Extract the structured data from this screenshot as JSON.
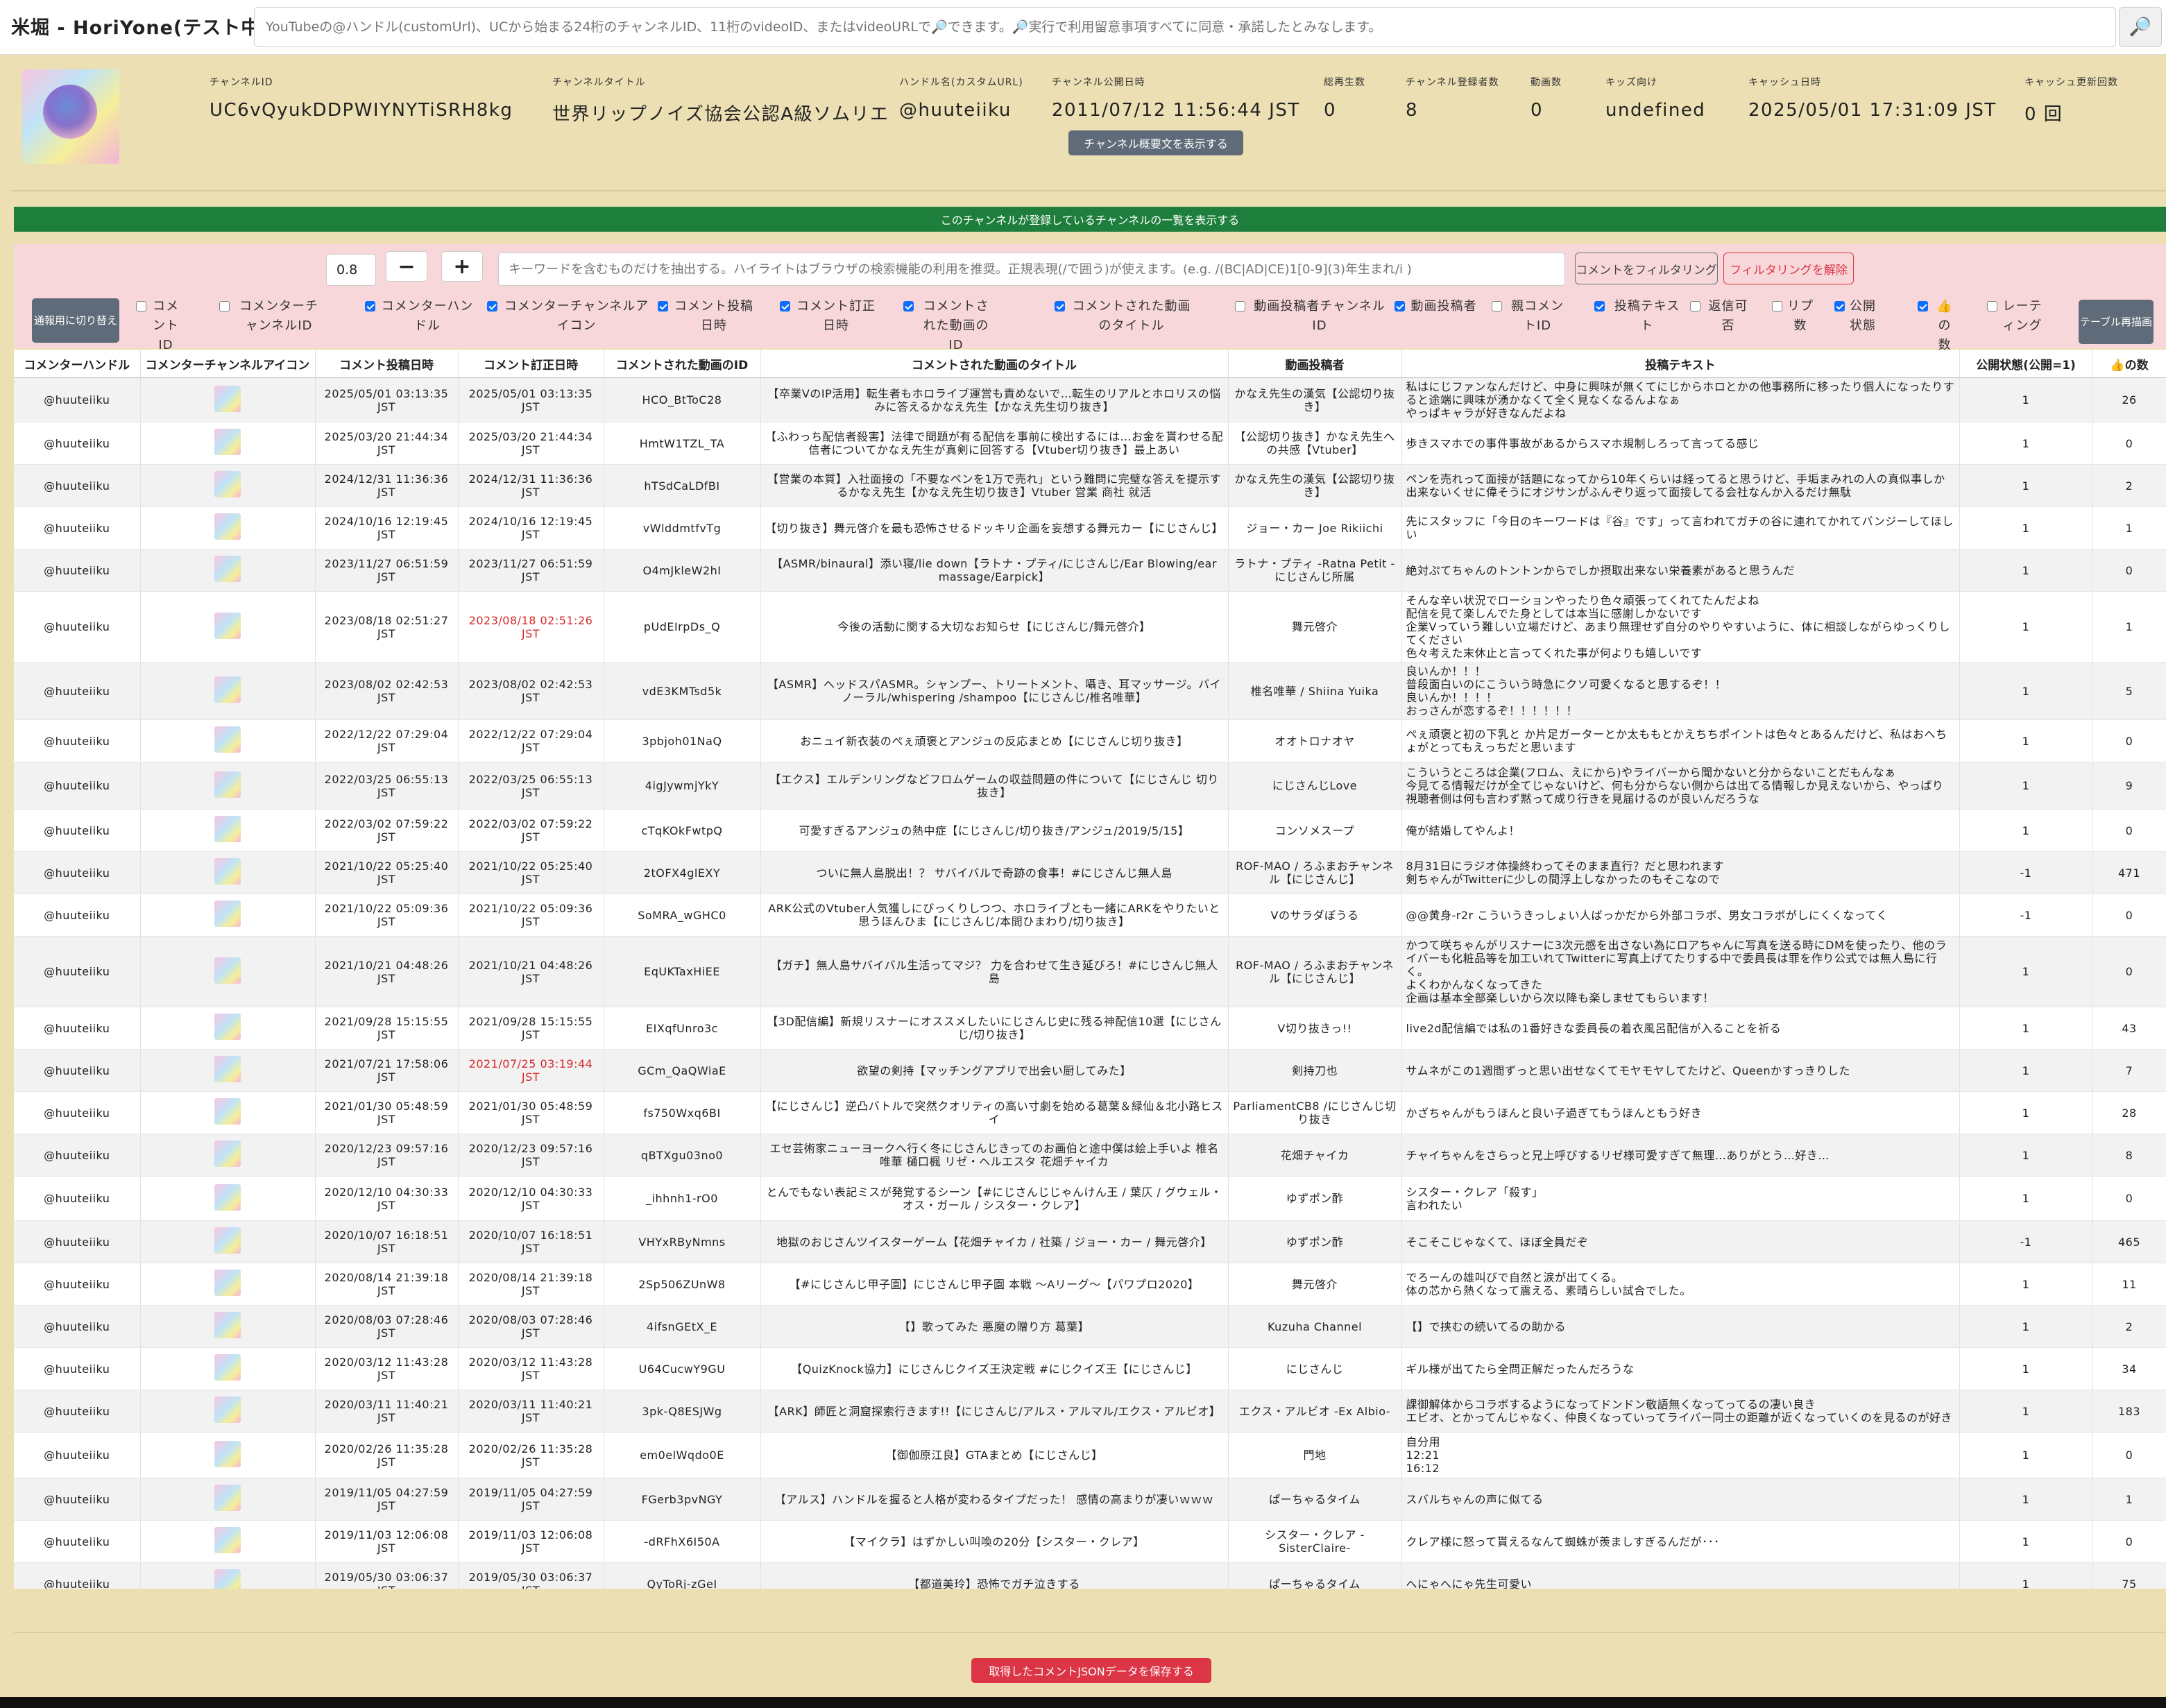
{
  "app": {
    "title": "米堀 - HoriYone(テスト中)"
  },
  "search": {
    "placeholder": "YouTubeの@ハンドル(customUrl)、UCから始まる24桁のチャンネルID、11桁のvideoID、またはvideoURLで🔎できます。🔎実行で利用留意事項すべてに同意・承諾したとみなします。",
    "icon": "search-icon"
  },
  "channel": {
    "fields": [
      {
        "label": "チャンネルID",
        "value": "UC6vQyukDDPWIYNYTiSRH8kg"
      },
      {
        "label": "チャンネルタイトル",
        "value": "世界リップノイズ協会公認A級ソムリエ"
      },
      {
        "label": "ハンドル名(カスタムURL)",
        "value": "@huuteiiku"
      },
      {
        "label": "チャンネル公開日時",
        "value": "2011/07/12 11:56:44 JST"
      },
      {
        "label": "総再生数",
        "value": "0"
      },
      {
        "label": "チャンネル登録者数",
        "value": "8"
      },
      {
        "label": "動画数",
        "value": "0"
      },
      {
        "label": "キッズ向け",
        "value": "undefined"
      },
      {
        "label": "キャッシュ日時",
        "value": "2025/05/01 17:31:09 JST"
      },
      {
        "label": "キャッシュ更新回数",
        "value": "0 回"
      }
    ],
    "desc_button": "チャンネル概要文を表示する"
  },
  "subscriptions_button": "このチャンネルが登録しているチャンネルの一覧を表示する",
  "filter": {
    "threshold": "0.8",
    "minus": "−",
    "plus": "+",
    "keyword_placeholder": "キーワードを含むものだけを抽出する。ハイライトはブラウザの検索機能の利用を推奨。正規表現(/で囲う)が使えます。(e.g. /(BC|AD|CE)1[0-9](3)年生まれ/i )",
    "filter_button": "コメントをフィルタリング",
    "clear_button": "フィルタリングを解除",
    "print_toggle": "通報用に切り替え",
    "redraw": "テーブル再描画"
  },
  "columns_toggle": [
    {
      "label": "コメントID",
      "checked": false
    },
    {
      "label": "コメンターチャンネルID",
      "checked": false
    },
    {
      "label": "コメンターハンドル",
      "checked": true
    },
    {
      "label": "コメンターチャンネルアイコン",
      "checked": true
    },
    {
      "label": "コメント投稿日時",
      "checked": true
    },
    {
      "label": "コメント訂正日時",
      "checked": true
    },
    {
      "label": "コメントされた動画のID",
      "checked": true
    },
    {
      "label": "コメントされた動画のタイトル",
      "checked": true
    },
    {
      "label": "動画投稿者チャンネルID",
      "checked": false
    },
    {
      "label": "動画投稿者",
      "checked": true
    },
    {
      "label": "親コメントID",
      "checked": false
    },
    {
      "label": "投稿テキスト",
      "checked": true
    },
    {
      "label": "返信可否",
      "checked": false
    },
    {
      "label": "リプ数",
      "checked": false
    },
    {
      "label": "公開状態",
      "checked": true
    },
    {
      "label": "👍の数",
      "checked": true
    },
    {
      "label": "レーティング",
      "checked": false
    }
  ],
  "table": {
    "headers": [
      "コメンターハンドル",
      "コメンターチャンネルアイコン",
      "コメント投稿日時",
      "コメント訂正日時",
      "コメントされた動画のID",
      "コメントされた動画のタイトル",
      "動画投稿者",
      "投稿テキスト",
      "公開状態(公開=1)",
      "👍の数"
    ],
    "rows": [
      {
        "handle": "@huuteiiku",
        "posted": "2025/05/01 03:13:35\nJST",
        "edited": "2025/05/01 03:13:35\nJST",
        "edited_red": false,
        "vid": "HCO_BtToC28",
        "title": "【卒業VのIP活用】転生者もホロライブ運営も責めないで…転生のリアルとホロリスの悩みに答えるかなえ先生【かなえ先生切り抜き】",
        "author": "かなえ先生の漢気【公認切り抜き】",
        "text": "私はにじファンなんだけど、中身に興味が無くてにじからホロとかの他事務所に移ったり個人になったりすると途端に興味が湧かなくて全く見なくなるんよなぁ\nやっぱキャラが好きなんだよね",
        "status": "1",
        "likes": "26"
      },
      {
        "handle": "@huuteiiku",
        "posted": "2025/03/20 21:44:34\nJST",
        "edited": "2025/03/20 21:44:34\nJST",
        "edited_red": false,
        "vid": "HmtW1TZL_TA",
        "title": "【ふわっち配信者殺害】法律で問題が有る配信を事前に検出するには…お金を貰わせる配信者についてかなえ先生が真剣に回答する【Vtuber切り抜き】最上あい",
        "author": "【公認切り抜き】かなえ先生への共感【Vtuber】",
        "text": "歩きスマホでの事件事故があるからスマホ規制しろって言ってる感じ",
        "status": "1",
        "likes": "0"
      },
      {
        "handle": "@huuteiiku",
        "posted": "2024/12/31 11:36:36\nJST",
        "edited": "2024/12/31 11:36:36\nJST",
        "edited_red": false,
        "vid": "hTSdCaLDfBI",
        "title": "【営業の本質】入社面接の「不要なペンを1万で売れ」という難問に完璧な答えを提示するかなえ先生【かなえ先生切り抜き】Vtuber 営業 商社 就活",
        "author": "かなえ先生の漢気【公認切り抜き】",
        "text": "ペンを売れって面接が話題になってから10年くらいは経ってると思うけど、手垢まみれの人の真似事しか出来ないくせに偉そうにオジサンがふんぞり返って面接してる会社なんか入るだけ無駄",
        "status": "1",
        "likes": "2"
      },
      {
        "handle": "@huuteiiku",
        "posted": "2024/10/16 12:19:45\nJST",
        "edited": "2024/10/16 12:19:45\nJST",
        "edited_red": false,
        "vid": "vWlddmtfvTg",
        "title": "【切り抜き】舞元啓介を最も恐怖させるドッキリ企画を妄想する舞元カー【にじさんじ】",
        "author": "ジョー・カー Joe Rikiichi",
        "text": "先にスタッフに「今日のキーワードは『谷』です」って言われてガチの谷に連れてかれてバンジーしてほしい",
        "status": "1",
        "likes": "1"
      },
      {
        "handle": "@huuteiiku",
        "posted": "2023/11/27 06:51:59\nJST",
        "edited": "2023/11/27 06:51:59\nJST",
        "edited_red": false,
        "vid": "O4mJkleW2hI",
        "title": "【ASMR/binaural】添い寝/lie down【ラトナ・プティ/にじさんじ/Ear Blowing/ear massage/Earpick】",
        "author": "ラトナ・プティ -Ratna Petit -にじさんじ所属",
        "text": "絶対ぷてちゃんのトントンからでしか摂取出来ない栄養素があると思うんだ",
        "status": "1",
        "likes": "0"
      },
      {
        "handle": "@huuteiiku",
        "posted": "2023/08/18 02:51:27\nJST",
        "edited": "2023/08/18 02:51:26\nJST",
        "edited_red": true,
        "vid": "pUdEIrpDs_Q",
        "title": "今後の活動に関する大切なお知らせ【にじさんじ/舞元啓介】",
        "author": "舞元啓介",
        "text": "そんな辛い状況でローションやったり色々頑張ってくれてたんだよね\n配信を見て楽しんでた身としては本当に感謝しかないです\n企業Vっていう難しい立場だけど、あまり無理せず自分のやりやすいように、体に相談しながらゆっくりしてください\n色々考えた末休止と言ってくれた事が何よりも嬉しいです",
        "status": "1",
        "likes": "1"
      },
      {
        "handle": "@huuteiiku",
        "posted": "2023/08/02 02:42:53\nJST",
        "edited": "2023/08/02 02:42:53\nJST",
        "edited_red": false,
        "vid": "vdE3KMTsd5k",
        "title": "【ASMR】ヘッドスパASMR。シャンプー、トリートメント、囁き、耳マッサージ。バイノーラル/whispering /shampoo【にじさんじ/椎名唯華】",
        "author": "椎名唯華 / Shiina Yuika",
        "text": "良いんか！！！\n普段面白いのにこういう時急にクソ可愛くなると思するぞ！！\n良いんか！！！！\nおっさんが恋するぞ！！！！！！",
        "status": "1",
        "likes": "5"
      },
      {
        "handle": "@huuteiiku",
        "posted": "2022/12/22 07:29:04\nJST",
        "edited": "2022/12/22 07:29:04\nJST",
        "edited_red": false,
        "vid": "3pbjoh01NaQ",
        "title": "おニュイ新衣装のぺぇ頑褒とアンジュの反応まとめ【にじさんじ切り抜き】",
        "author": "オオトロナオヤ",
        "text": "ぺぇ頑褒と初の下乳と か片足ガーターとか太ももとかえちちポイントは色々とあるんだけど、私はおへちょがとってもえっちだと思います",
        "status": "1",
        "likes": "0"
      },
      {
        "handle": "@huuteiiku",
        "posted": "2022/03/25 06:55:13\nJST",
        "edited": "2022/03/25 06:55:13\nJST",
        "edited_red": false,
        "vid": "4igJywmjYkY",
        "title": "【エクス】エルデンリングなどフロムゲームの収益問題の件について【にじさんじ 切り抜き】",
        "author": "にじさんじLove",
        "text": "こういうところは企業(フロム、えにから)やライバーから聞かないと分からないことだもんなぁ\n今見てる情報だけが全てじゃないけど、何も分からない側からは出てる情報しか見えないから、やっぱり視聴者側は何も言わず黙って成り行きを見届けるのが良いんだろうな",
        "status": "1",
        "likes": "9"
      },
      {
        "handle": "@huuteiiku",
        "posted": "2022/03/02 07:59:22\nJST",
        "edited": "2022/03/02 07:59:22\nJST",
        "edited_red": false,
        "vid": "cTqKOkFwtpQ",
        "title": "可愛すぎるアンジュの熱中症【にじさんじ/切り抜き/アンジュ/2019/5/15】",
        "author": "コンソメスープ",
        "text": "俺が結婚してやんよ！",
        "status": "1",
        "likes": "0"
      },
      {
        "handle": "@huuteiiku",
        "posted": "2021/10/22 05:25:40\nJST",
        "edited": "2021/10/22 05:25:40\nJST",
        "edited_red": false,
        "vid": "2tOFX4glEXY",
        "title": "ついに無人島脱出！？ サバイバルで奇跡の食事！#にじさんじ無人島",
        "author": "ROF-MAO / ろふまおチャンネル【にじさんじ】",
        "text": "8月31日にラジオ体操終わってそのまま直行？だと思われます\n剣ちゃんがTwitterに少しの間浮上しなかったのもそこなので",
        "status": "-1",
        "likes": "471"
      },
      {
        "handle": "@huuteiiku",
        "posted": "2021/10/22 05:09:36\nJST",
        "edited": "2021/10/22 05:09:36\nJST",
        "edited_red": false,
        "vid": "SoMRA_wGHC0",
        "title": "ARK公式のVtuber人気獲しにびっくりしつつ、ホロライブとも一緒にARKをやりたいと思うほんひま【にじさんじ/本間ひまわり/切り抜き】",
        "author": "Vのサラダぼうる",
        "text": "@@黄身-r2r こういうきっしょい人ばっかだから外部コラボ、男女コラボがしにくくなってく",
        "status": "-1",
        "likes": "0"
      },
      {
        "handle": "@huuteiiku",
        "posted": "2021/10/21 04:48:26\nJST",
        "edited": "2021/10/21 04:48:26\nJST",
        "edited_red": false,
        "vid": "EqUKTaxHiEE",
        "title": "【ガチ】無人島サバイバル生活ってマジ？ 力を合わせて生き延びろ！#にじさんじ無人島",
        "author": "ROF-MAO / ろふまおチャンネル【にじさんじ】",
        "text": "かつて咲ちゃんがリスナーに3次元感を出さない為にロアちゃんに写真を送る時にDMを使ったり、他のライバーも化粧品等を加工いれてTwitterに写真上げてたりする中で委員長は罪を作り公式では無人島に行く。\nよくわかんなくなってきた\n企画は基本全部楽しいから次以降も楽しませてもらいます！",
        "status": "1",
        "likes": "0"
      },
      {
        "handle": "@huuteiiku",
        "posted": "2021/09/28 15:15:55\nJST",
        "edited": "2021/09/28 15:15:55\nJST",
        "edited_red": false,
        "vid": "EIXqfUnro3c",
        "title": "【3D配信編】新規リスナーにオススメしたいにじさんじ史に残る神配信10選【にじさんじ/切り抜き】",
        "author": "V切り抜きっ!!",
        "text": "live2d配信編では私の1番好きな委員長の着衣風呂配信が入ることを祈る",
        "status": "1",
        "likes": "43"
      },
      {
        "handle": "@huuteiiku",
        "posted": "2021/07/21 17:58:06\nJST",
        "edited": "2021/07/25 03:19:44\nJST",
        "edited_red": true,
        "vid": "GCm_QaQWiaE",
        "title": "欲望の剣持【マッチングアプリで出会い厨してみた】",
        "author": "剣持刀也",
        "text": "サムネがこの1週間ずっと思い出せなくてモヤモヤしてたけど、Queenかすっきりした",
        "status": "1",
        "likes": "7"
      },
      {
        "handle": "@huuteiiku",
        "posted": "2021/01/30 05:48:59\nJST",
        "edited": "2021/01/30 05:48:59\nJST",
        "edited_red": false,
        "vid": "fs750Wxq6BI",
        "title": "【にじさんじ】逆凸バトルで突然クオリティの高い寸劇を始める葛葉＆緑仙＆北小路ヒスイ",
        "author": "ParliamentCB8 /にじさんじ切り抜き",
        "text": "かざちゃんがもうほんと良い子過ぎてもうほんともう好き",
        "status": "1",
        "likes": "28"
      },
      {
        "handle": "@huuteiiku",
        "posted": "2020/12/23 09:57:16\nJST",
        "edited": "2020/12/23 09:57:16\nJST",
        "edited_red": false,
        "vid": "qBTXgu03no0",
        "title": "エセ芸術家ニューヨークへ行く冬にじさんじきってのお画伯と途中僕は絵上手いよ 椎名唯華 樋口楓 リゼ・ヘルエスタ 花畑チャイカ",
        "author": "花畑チャイカ",
        "text": "チャイちゃんをさらっと兄上呼びするリゼ様可愛すぎて無理…ありがとう…好き…",
        "status": "1",
        "likes": "8"
      },
      {
        "handle": "@huuteiiku",
        "posted": "2020/12/10 04:30:33\nJST",
        "edited": "2020/12/10 04:30:33\nJST",
        "edited_red": false,
        "vid": "_ihhnh1-rO0",
        "title": "とんでもない表記ミスが発覚するシーン【#にじさんじじゃんけん王 / 葉仄 / グウェル・オス・ガール / シスター・クレア】",
        "author": "ゆずポン酢",
        "text": "シスター・クレア「殺す」\n言われたい",
        "status": "1",
        "likes": "0"
      },
      {
        "handle": "@huuteiiku",
        "posted": "2020/10/07 16:18:51\nJST",
        "edited": "2020/10/07 16:18:51\nJST",
        "edited_red": false,
        "vid": "VHYxRByNmns",
        "title": "地獄のおじさんツイスターゲーム【花畑チャイカ / 社築 / ジョー・カー / 舞元啓介】",
        "author": "ゆずポン酢",
        "text": "そこそこじゃなくて、ほぼ全員だぞ",
        "status": "-1",
        "likes": "465"
      },
      {
        "handle": "@huuteiiku",
        "posted": "2020/08/14 21:39:18\nJST",
        "edited": "2020/08/14 21:39:18\nJST",
        "edited_red": false,
        "vid": "2Sp506ZUnW8",
        "title": "【#にじさんじ甲子園】にじさんじ甲子園 本戦 〜Aリーグ〜【パワプロ2020】",
        "author": "舞元啓介",
        "text": "でろーんの雄叫びで自然と涙が出てくる。\n体の芯から熱くなって震える、素晴らしい試合でした。",
        "status": "1",
        "likes": "11"
      },
      {
        "handle": "@huuteiiku",
        "posted": "2020/08/03 07:28:46\nJST",
        "edited": "2020/08/03 07:28:46\nJST",
        "edited_red": false,
        "vid": "4ifsnGEtX_E",
        "title": "【】歌ってみた 悪魔の贈り方 葛葉】",
        "author": "Kuzuha Channel",
        "text": "【】で挟むの続いてるの助かる",
        "status": "1",
        "likes": "2"
      },
      {
        "handle": "@huuteiiku",
        "posted": "2020/03/12 11:43:28\nJST",
        "edited": "2020/03/12 11:43:28\nJST",
        "edited_red": false,
        "vid": "U64CucwY9GU",
        "title": "【QuizKnock協力】にじさんじクイズ王決定戦 #にじクイズ王【にじさんじ】",
        "author": "にじさんじ",
        "text": "ギル様が出てたら全問正解だったんだろうな",
        "status": "1",
        "likes": "34"
      },
      {
        "handle": "@huuteiiku",
        "posted": "2020/03/11 11:40:21\nJST",
        "edited": "2020/03/11 11:40:21\nJST",
        "edited_red": false,
        "vid": "3pk-Q8ESJWg",
        "title": "【ARK】師匠と洞窟探索行きます!!【にじさんじ/アルス・アルマル/エクス・アルビオ】",
        "author": "エクス・アルビオ -Ex Albio-",
        "text": "課御解体からコラボするようになってドンドン敬語無くなってってるの凄い良き\nエビオ、とかってんじゃなく、仲良くなっていってライバー同士の距離が近くなっていくのを見るのが好き",
        "status": "1",
        "likes": "183"
      },
      {
        "handle": "@huuteiiku",
        "posted": "2020/02/26 11:35:28\nJST",
        "edited": "2020/02/26 11:35:28\nJST",
        "edited_red": false,
        "vid": "em0elWqdo0E",
        "title": "【御伽原江良】GTAまとめ【にじさんじ】",
        "author": "門地",
        "text": "自分用\n12:21\n16:12",
        "status": "1",
        "likes": "0"
      },
      {
        "handle": "@huuteiiku",
        "posted": "2019/11/05 04:27:59\nJST",
        "edited": "2019/11/05 04:27:59\nJST",
        "edited_red": false,
        "vid": "FGerb3pvNGY",
        "title": "【アルス】ハンドルを握ると人格が変わるタイプだった！ 感情の高まりが凄いｗｗｗ",
        "author": "ぱーちゃるタイム",
        "text": "スバルちゃんの声に似てる",
        "status": "1",
        "likes": "1"
      },
      {
        "handle": "@huuteiiku",
        "posted": "2019/11/03 12:06:08\nJST",
        "edited": "2019/11/03 12:06:08\nJST",
        "edited_red": false,
        "vid": "-dRFhX6I50A",
        "title": "【マイクラ】はずかしい叫喚の20分【シスター・クレア】",
        "author": "シスター・クレア -SisterClaire-",
        "text": "クレア様に怒って貰えるなんて蜘蛛が羨ましすぎるんだが･･･",
        "status": "1",
        "likes": "0"
      },
      {
        "handle": "@huuteiiku",
        "posted": "2019/05/30 03:06:37\nJST",
        "edited": "2019/05/30 03:06:37\nJST",
        "edited_red": false,
        "vid": "QyToRj-zGeI",
        "title": "【都道美玲】恐怖でガチ泣きする",
        "author": "ぱーちゃるタイム",
        "text": "へにゃへにゃ先生可愛い",
        "status": "1",
        "likes": "75"
      }
    ]
  },
  "save_button": "取得したコメントJSONデータを保存する"
}
